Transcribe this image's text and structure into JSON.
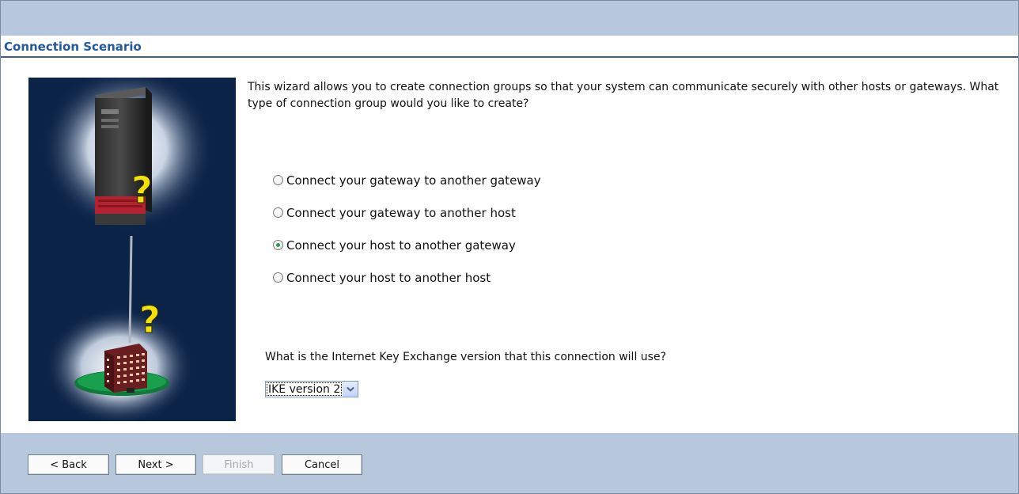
{
  "section": {
    "title": "Connection Scenario"
  },
  "intro": {
    "text": "This wizard allows you to create connection groups so that your system can communicate securely with other hosts or gateways.  What type of connection group would you like to create?"
  },
  "scenarios": [
    {
      "label": "Connect your gateway to another gateway",
      "checked": false
    },
    {
      "label": "Connect your gateway to another host",
      "checked": false
    },
    {
      "label": "Connect your host to another gateway",
      "checked": true
    },
    {
      "label": "Connect your host to another host",
      "checked": false
    }
  ],
  "ike": {
    "question": "What is the Internet Key Exchange version that this connection will use?",
    "selected": "IKE version 2"
  },
  "buttons": {
    "back": "< Back",
    "next": "Next >",
    "finish": "Finish",
    "cancel": "Cancel"
  },
  "illustration": {
    "icons": [
      "server-icon",
      "question-mark-icon",
      "building-icon"
    ]
  },
  "colors": {
    "band": "#b7c7dc",
    "title": "#23599e",
    "illustration_bg": "#0b2347",
    "question_mark": "#f5e10a"
  }
}
